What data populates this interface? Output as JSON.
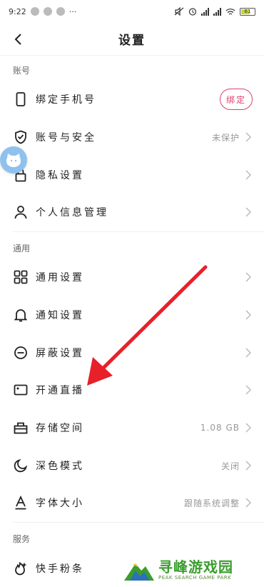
{
  "status_bar": {
    "time": "9:22",
    "more": "···",
    "battery": "61"
  },
  "nav": {
    "title": "设置"
  },
  "sections": {
    "account": "账号",
    "general": "通用",
    "service": "服务"
  },
  "rows": {
    "bind_phone": {
      "label": "绑定手机号",
      "button": "绑定"
    },
    "account_security": {
      "label": "账号与安全",
      "value": "未保护"
    },
    "privacy": {
      "label": "隐私设置"
    },
    "personal_info": {
      "label": "个人信息管理"
    },
    "general_settings": {
      "label": "通用设置"
    },
    "notifications": {
      "label": "通知设置"
    },
    "block": {
      "label": "屏蔽设置"
    },
    "live": {
      "label": "开通直播"
    },
    "storage": {
      "label": "存储空间",
      "value": "1.08 GB"
    },
    "dark_mode": {
      "label": "深色模式",
      "value": "关闭"
    },
    "font_size": {
      "label": "字体大小",
      "value": "跟随系统调整"
    },
    "fans": {
      "label": "快手粉条"
    }
  },
  "watermark": {
    "main": "寻峰游戏园",
    "sub": "PEAK SEARCH GAME PARK"
  },
  "colors": {
    "accent": "#e0416e",
    "arrow": "#e8202a"
  }
}
